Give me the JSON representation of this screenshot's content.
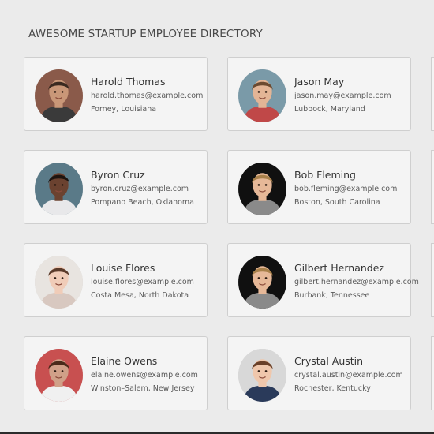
{
  "header": {
    "title": "AWESOME STARTUP EMPLOYEE DIRECTORY"
  },
  "employees": [
    {
      "name": "Harold Thomas",
      "email": "harold.thomas@example.com",
      "location": "Forney, Louisiana",
      "skin": "#c99778",
      "hair": "#3a2a20",
      "bg": "#8a5a4a",
      "shirt": "#3a3a3a"
    },
    {
      "name": "Jason May",
      "email": "jason.may@example.com",
      "location": "Lubbock, Maryland",
      "skin": "#e3b596",
      "hair": "#6b4a30",
      "bg": "#7a9aa8",
      "shirt": "#c04848"
    },
    {
      "name": "Byron Cruz",
      "email": "byron.cruz@example.com",
      "location": "Pompano Beach, Oklahoma",
      "skin": "#6b4230",
      "hair": "#1e1410",
      "bg": "#5a7a88",
      "shirt": "#e8e8ea"
    },
    {
      "name": "Bob Fleming",
      "email": "bob.fleming@example.com",
      "location": "Boston, South Carolina",
      "skin": "#e6b898",
      "hair": "#a8804a",
      "bg": "#101010",
      "shirt": "#8a8a8a"
    },
    {
      "name": "Louise Flores",
      "email": "louise.flores@example.com",
      "location": "Costa Mesa, North Dakota",
      "skin": "#f0ccb8",
      "hair": "#5a3a2a",
      "bg": "#e8e4e0",
      "shirt": "#d8c8c0"
    },
    {
      "name": "Gilbert Hernandez",
      "email": "gilbert.hernandez@example.com",
      "location": "Burbank, Tennessee",
      "skin": "#e6b898",
      "hair": "#a8804a",
      "bg": "#101010",
      "shirt": "#8a8a8a"
    },
    {
      "name": "Elaine Owens",
      "email": "elaine.owens@example.com",
      "location": "Winston–Salem, New Jersey",
      "skin": "#d0a088",
      "hair": "#4a2a1a",
      "bg": "#c85050",
      "shirt": "#f0f0f0"
    },
    {
      "name": "Crystal Austin",
      "email": "crystal.austin@example.com",
      "location": "Rochester, Kentucky",
      "skin": "#efc7ac",
      "hair": "#6a4028",
      "bg": "#d8d8d8",
      "shirt": "#2a3a5a"
    }
  ]
}
